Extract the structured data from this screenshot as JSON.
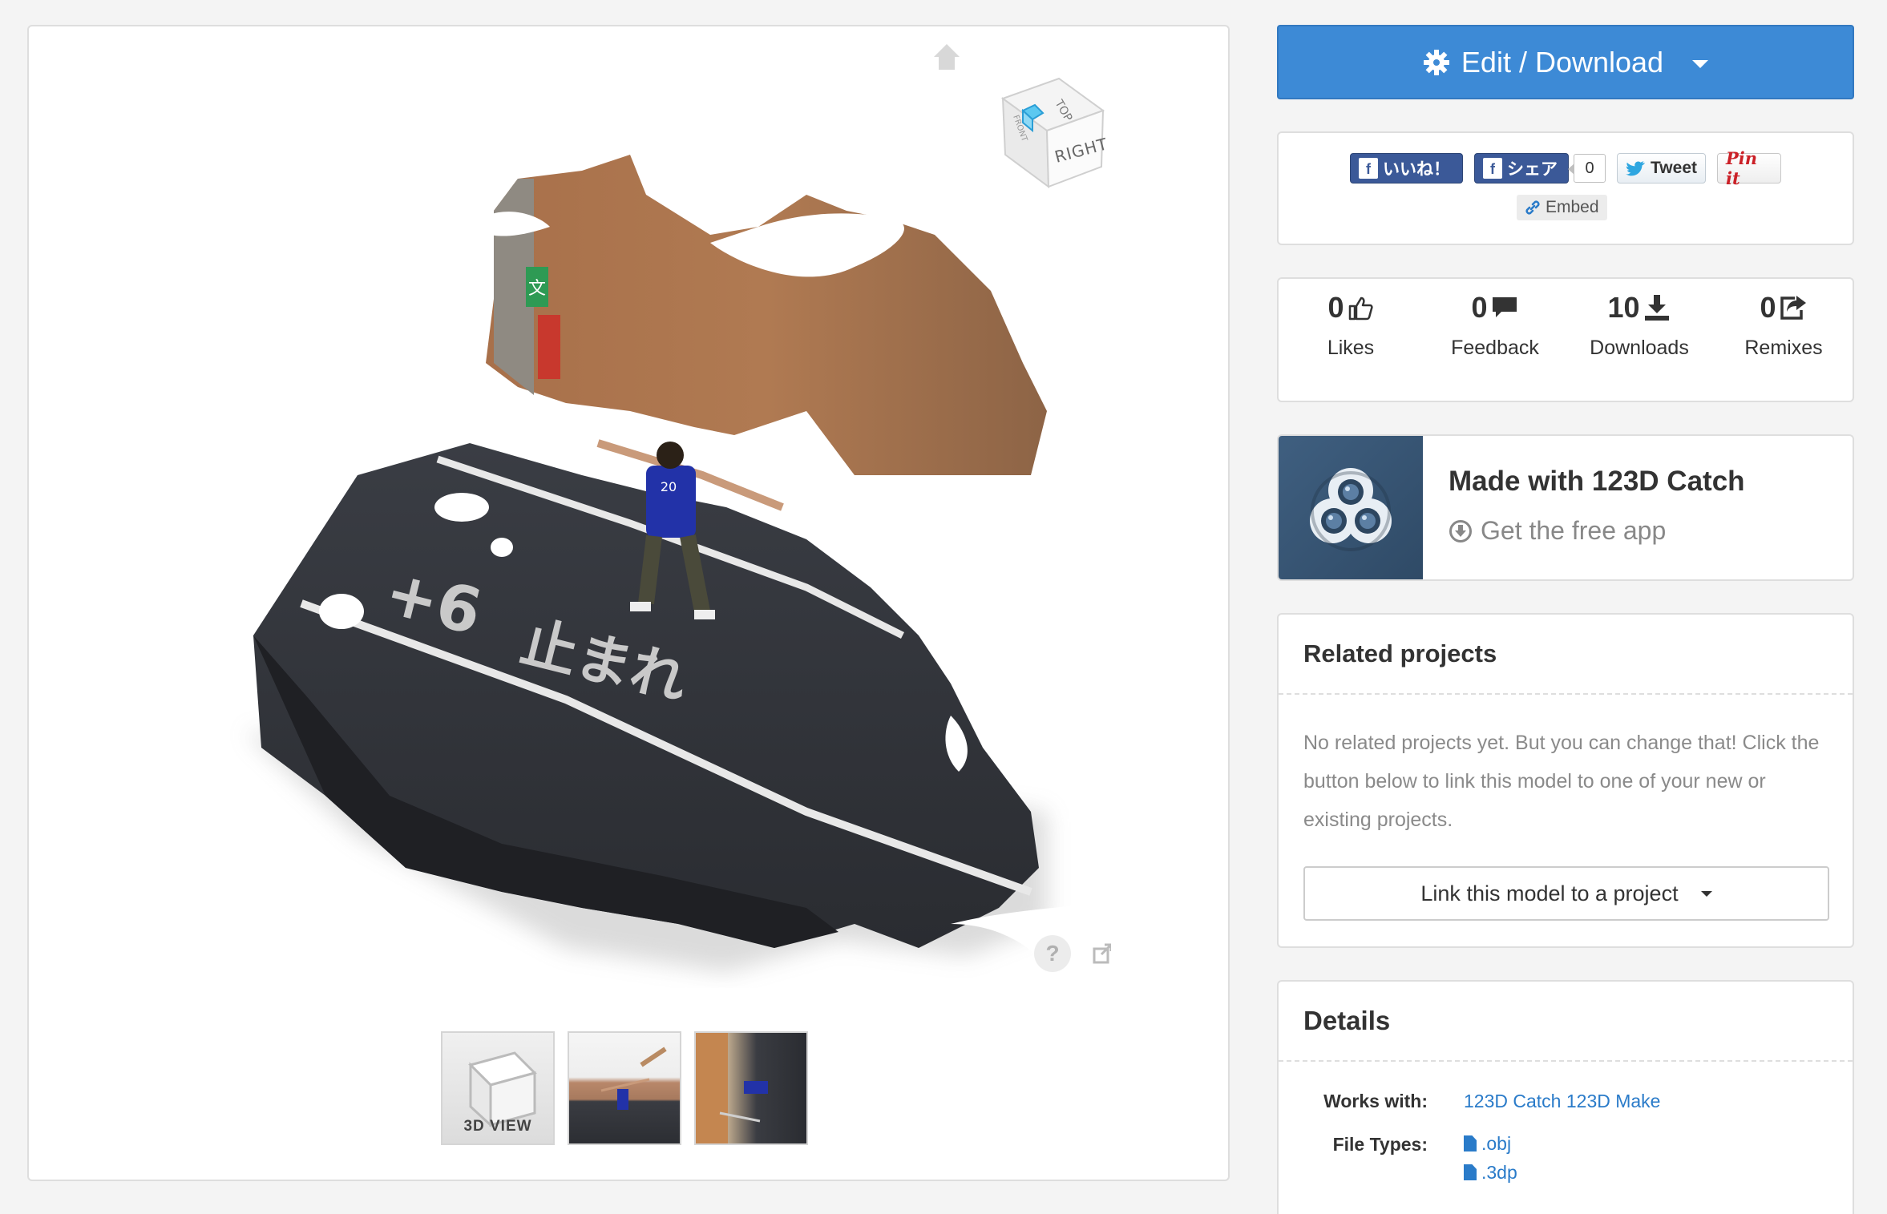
{
  "viewer": {
    "viewcube": {
      "top_face": "TOP",
      "front_face": "FRONT",
      "right_face": "RIGHT"
    },
    "street_markings": [
      "+6",
      "止まれ"
    ],
    "sign_text": "文",
    "jersey_number": "20",
    "help_label": "?",
    "thumbnails": [
      {
        "label": "3D VIEW"
      },
      {
        "label": ""
      },
      {
        "label": ""
      }
    ]
  },
  "edit_button": {
    "label": "Edit / Download"
  },
  "social": {
    "fb_like_label": "いいね！",
    "fb_share_label": "シェア",
    "fb_share_count": "0",
    "tweet_label": "Tweet",
    "pinit_label": "Pin it",
    "embed_label": "Embed"
  },
  "stats": [
    {
      "count": "0",
      "label": "Likes",
      "icon": "thumbs-up-icon"
    },
    {
      "count": "0",
      "label": "Feedback",
      "icon": "comment-icon"
    },
    {
      "count": "10",
      "label": "Downloads",
      "icon": "download-icon"
    },
    {
      "count": "0",
      "label": "Remixes",
      "icon": "share-icon"
    }
  ],
  "made_with": {
    "title": "Made with 123D Catch",
    "cta": "Get the free app"
  },
  "related": {
    "title": "Related projects",
    "text": "No related projects yet. But you can change that! Click the button below to link this model to one of your new or existing projects.",
    "button_label": "Link this model to a project"
  },
  "details": {
    "title": "Details",
    "works_with_label": "Works with:",
    "works_with": [
      "123D Catch",
      "123D Make"
    ],
    "file_types_label": "File Types:",
    "file_types": [
      ".obj",
      ".3dp"
    ]
  },
  "colors": {
    "primary": "#3d8ad6",
    "link": "#2a7bc9",
    "facebook": "#3b5998",
    "pinterest": "#cb2027"
  }
}
